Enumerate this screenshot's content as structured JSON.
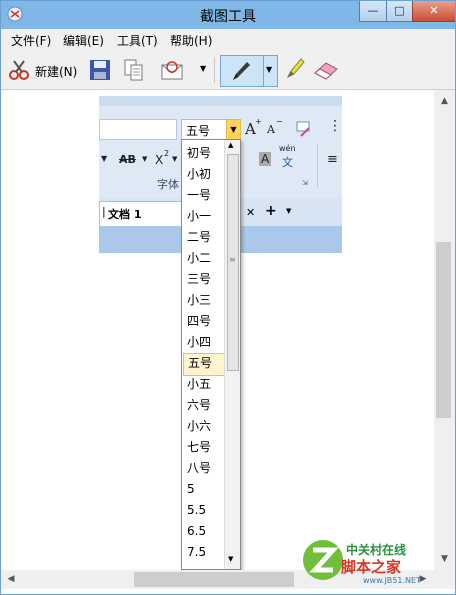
{
  "window": {
    "title": "截图工具"
  },
  "menu": [
    "文件(F)",
    "编辑(E)",
    "工具(T)",
    "帮助(H)"
  ],
  "toolbar": {
    "new_label": "新建(N)"
  },
  "captured": {
    "size_value": "五号",
    "size_options": [
      "初号",
      "小初",
      "一号",
      "小一",
      "二号",
      "小二",
      "三号",
      "小三",
      "四号",
      "小四",
      "五号",
      "小五",
      "六号",
      "小六",
      "七号",
      "八号",
      "5",
      "5.5",
      "6.5",
      "7.5"
    ],
    "selected_option": "五号",
    "group_label": "字体",
    "doc_tab": "文档 1",
    "ribbon_glyphs": {
      "grow_font": "A",
      "shrink_font": "A",
      "strike": "AB",
      "superscript": "X",
      "shade": "A",
      "phonetic_top": "wén",
      "phonetic_bottom": "文"
    }
  },
  "watermark": {
    "line1": "中关村在线",
    "line2": "脚本之家",
    "line3": "www.JB51.NET"
  }
}
